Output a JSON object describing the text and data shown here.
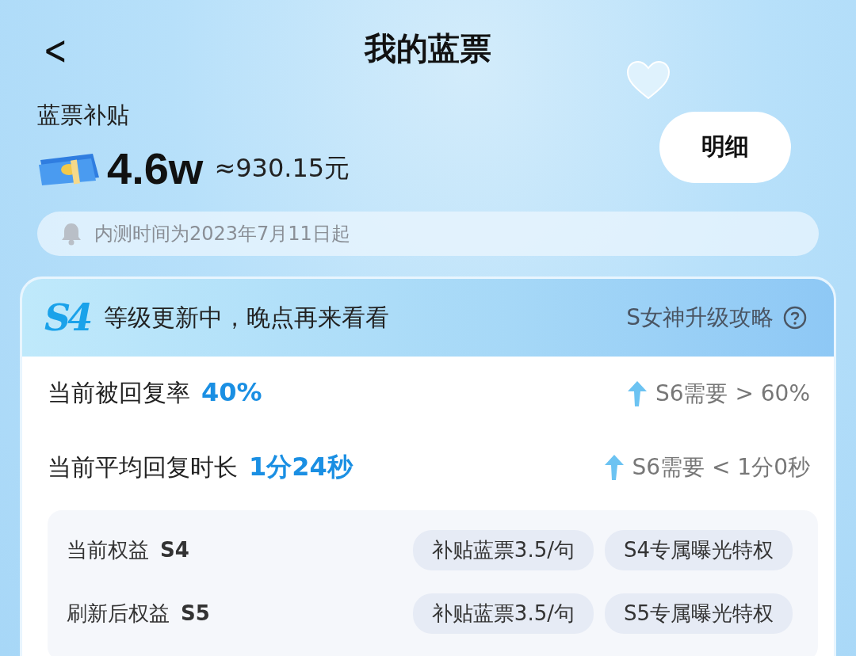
{
  "header": {
    "back": "<",
    "title": "我的蓝票"
  },
  "subsidy": {
    "label": "蓝票补贴",
    "amount": "4.6w",
    "approx": "≈930.15元",
    "detail_button": "明细"
  },
  "notice": {
    "text": "内测时间为2023年7月11日起"
  },
  "level_card": {
    "badge": "S4",
    "status": "等级更新中，晚点再来看看",
    "guide_link": "S女神升级攻略",
    "metrics": [
      {
        "label": "当前被回复率",
        "value": "40%",
        "requirement": "S6需要 > 60%"
      },
      {
        "label": "当前平均回复时长",
        "value": "1分24秒",
        "requirement": "S6需要 < 1分0秒"
      }
    ],
    "benefits": [
      {
        "label": "当前权益",
        "level": "S4",
        "tags": [
          "补贴蓝票3.5/句",
          "S4专属曝光特权"
        ]
      },
      {
        "label": "刷新后权益",
        "level": "S5",
        "tags": [
          "补贴蓝票3.5/句",
          "S5专属曝光特权"
        ]
      }
    ]
  }
}
